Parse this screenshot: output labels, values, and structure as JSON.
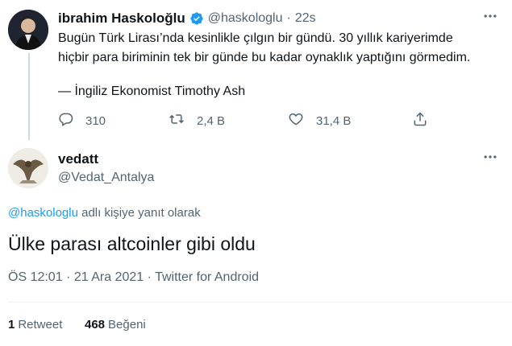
{
  "quoted_tweet": {
    "display_name": "ibrahim Haskoloğlu",
    "handle": "@haskologlu",
    "separator": "·",
    "time_ago": "22s",
    "text_line1": "Bugün Türk Lirası’nda kesinlikle çılgın bir gündü. 30 yıllık kariyerimde",
    "text_line2": "hiçbir para biriminin tek bir günde bu kadar oynaklık yaptığını görmedim.",
    "text_line3": "— İngiliz Ekonomist Timothy Ash",
    "replies": "310",
    "retweets": "2,4 B",
    "likes": "31,4 B",
    "verified": true
  },
  "reply_tweet": {
    "display_name": "vedatt",
    "handle": "@Vedat_Antalya",
    "reply_to_handle": "@haskologlu",
    "reply_to_suffix": "adlı kişiye yanıt olarak",
    "text": "Ülke parası altcoinler gibi oldu",
    "time": "ÖS 12:01",
    "sep1": "·",
    "date": "21 Ara 2021",
    "sep2": "·",
    "source": "Twitter for Android",
    "retweet_count": "1",
    "retweet_label": "Retweet",
    "like_count": "468",
    "like_label": "Beğeni"
  },
  "icons": {
    "verified": "verified-badge-icon",
    "more": "more-horizontal-icon",
    "reply": "reply-icon",
    "retweet": "retweet-icon",
    "like": "heart-icon",
    "share": "share-icon"
  },
  "colors": {
    "accent": "#1d9bf0",
    "muted": "#536471",
    "text": "#0f1419",
    "divider": "#eff3f4"
  }
}
